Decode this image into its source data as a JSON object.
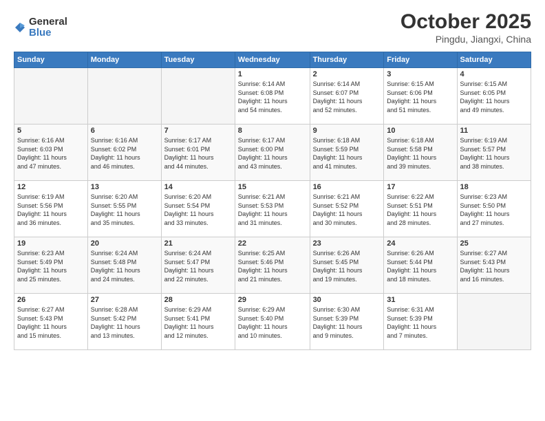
{
  "logo": {
    "general": "General",
    "blue": "Blue"
  },
  "header": {
    "month": "October 2025",
    "location": "Pingdu, Jiangxi, China"
  },
  "weekdays": [
    "Sunday",
    "Monday",
    "Tuesday",
    "Wednesday",
    "Thursday",
    "Friday",
    "Saturday"
  ],
  "weeks": [
    [
      {
        "day": "",
        "info": ""
      },
      {
        "day": "",
        "info": ""
      },
      {
        "day": "",
        "info": ""
      },
      {
        "day": "1",
        "info": "Sunrise: 6:14 AM\nSunset: 6:08 PM\nDaylight: 11 hours\nand 54 minutes."
      },
      {
        "day": "2",
        "info": "Sunrise: 6:14 AM\nSunset: 6:07 PM\nDaylight: 11 hours\nand 52 minutes."
      },
      {
        "day": "3",
        "info": "Sunrise: 6:15 AM\nSunset: 6:06 PM\nDaylight: 11 hours\nand 51 minutes."
      },
      {
        "day": "4",
        "info": "Sunrise: 6:15 AM\nSunset: 6:05 PM\nDaylight: 11 hours\nand 49 minutes."
      }
    ],
    [
      {
        "day": "5",
        "info": "Sunrise: 6:16 AM\nSunset: 6:03 PM\nDaylight: 11 hours\nand 47 minutes."
      },
      {
        "day": "6",
        "info": "Sunrise: 6:16 AM\nSunset: 6:02 PM\nDaylight: 11 hours\nand 46 minutes."
      },
      {
        "day": "7",
        "info": "Sunrise: 6:17 AM\nSunset: 6:01 PM\nDaylight: 11 hours\nand 44 minutes."
      },
      {
        "day": "8",
        "info": "Sunrise: 6:17 AM\nSunset: 6:00 PM\nDaylight: 11 hours\nand 43 minutes."
      },
      {
        "day": "9",
        "info": "Sunrise: 6:18 AM\nSunset: 5:59 PM\nDaylight: 11 hours\nand 41 minutes."
      },
      {
        "day": "10",
        "info": "Sunrise: 6:18 AM\nSunset: 5:58 PM\nDaylight: 11 hours\nand 39 minutes."
      },
      {
        "day": "11",
        "info": "Sunrise: 6:19 AM\nSunset: 5:57 PM\nDaylight: 11 hours\nand 38 minutes."
      }
    ],
    [
      {
        "day": "12",
        "info": "Sunrise: 6:19 AM\nSunset: 5:56 PM\nDaylight: 11 hours\nand 36 minutes."
      },
      {
        "day": "13",
        "info": "Sunrise: 6:20 AM\nSunset: 5:55 PM\nDaylight: 11 hours\nand 35 minutes."
      },
      {
        "day": "14",
        "info": "Sunrise: 6:20 AM\nSunset: 5:54 PM\nDaylight: 11 hours\nand 33 minutes."
      },
      {
        "day": "15",
        "info": "Sunrise: 6:21 AM\nSunset: 5:53 PM\nDaylight: 11 hours\nand 31 minutes."
      },
      {
        "day": "16",
        "info": "Sunrise: 6:21 AM\nSunset: 5:52 PM\nDaylight: 11 hours\nand 30 minutes."
      },
      {
        "day": "17",
        "info": "Sunrise: 6:22 AM\nSunset: 5:51 PM\nDaylight: 11 hours\nand 28 minutes."
      },
      {
        "day": "18",
        "info": "Sunrise: 6:23 AM\nSunset: 5:50 PM\nDaylight: 11 hours\nand 27 minutes."
      }
    ],
    [
      {
        "day": "19",
        "info": "Sunrise: 6:23 AM\nSunset: 5:49 PM\nDaylight: 11 hours\nand 25 minutes."
      },
      {
        "day": "20",
        "info": "Sunrise: 6:24 AM\nSunset: 5:48 PM\nDaylight: 11 hours\nand 24 minutes."
      },
      {
        "day": "21",
        "info": "Sunrise: 6:24 AM\nSunset: 5:47 PM\nDaylight: 11 hours\nand 22 minutes."
      },
      {
        "day": "22",
        "info": "Sunrise: 6:25 AM\nSunset: 5:46 PM\nDaylight: 11 hours\nand 21 minutes."
      },
      {
        "day": "23",
        "info": "Sunrise: 6:26 AM\nSunset: 5:45 PM\nDaylight: 11 hours\nand 19 minutes."
      },
      {
        "day": "24",
        "info": "Sunrise: 6:26 AM\nSunset: 5:44 PM\nDaylight: 11 hours\nand 18 minutes."
      },
      {
        "day": "25",
        "info": "Sunrise: 6:27 AM\nSunset: 5:43 PM\nDaylight: 11 hours\nand 16 minutes."
      }
    ],
    [
      {
        "day": "26",
        "info": "Sunrise: 6:27 AM\nSunset: 5:43 PM\nDaylight: 11 hours\nand 15 minutes."
      },
      {
        "day": "27",
        "info": "Sunrise: 6:28 AM\nSunset: 5:42 PM\nDaylight: 11 hours\nand 13 minutes."
      },
      {
        "day": "28",
        "info": "Sunrise: 6:29 AM\nSunset: 5:41 PM\nDaylight: 11 hours\nand 12 minutes."
      },
      {
        "day": "29",
        "info": "Sunrise: 6:29 AM\nSunset: 5:40 PM\nDaylight: 11 hours\nand 10 minutes."
      },
      {
        "day": "30",
        "info": "Sunrise: 6:30 AM\nSunset: 5:39 PM\nDaylight: 11 hours\nand 9 minutes."
      },
      {
        "day": "31",
        "info": "Sunrise: 6:31 AM\nSunset: 5:39 PM\nDaylight: 11 hours\nand 7 minutes."
      },
      {
        "day": "",
        "info": ""
      }
    ]
  ]
}
